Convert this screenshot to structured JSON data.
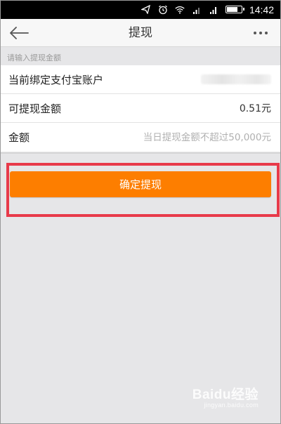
{
  "status_bar": {
    "time": "14:42",
    "icons": [
      "send-icon",
      "alarm-icon",
      "wifi-icon",
      "signal-icon",
      "signal-icon",
      "battery-icon"
    ]
  },
  "nav": {
    "title": "提现",
    "back_icon": "arrow-left-icon",
    "more_icon": "more-horizontal-icon"
  },
  "form": {
    "section_hint": "请输入提现金额",
    "account_label": "当前绑定支付宝账户",
    "account_value_hidden": true,
    "withdrawable_label": "可提现金额",
    "withdrawable_value": "0.51元",
    "amount_label": "金额",
    "amount_placeholder": "当日提现金额不超过50,000元",
    "amount_value": ""
  },
  "actions": {
    "confirm_label": "确定提现",
    "highlight_color": "#e83a4a"
  },
  "watermark": {
    "main": "Baidu经验",
    "sub": "jingyan.baidu.com"
  },
  "colors": {
    "accent": "#fd7e00",
    "background": "#e6e6e8"
  }
}
